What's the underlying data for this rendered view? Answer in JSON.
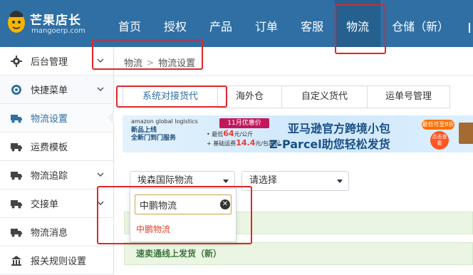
{
  "brand": {
    "name": "芒果店长",
    "url": "mangoerp.com"
  },
  "top_nav": [
    {
      "label": "首页"
    },
    {
      "label": "授权"
    },
    {
      "label": "产品"
    },
    {
      "label": "订单"
    },
    {
      "label": "客服"
    },
    {
      "label": "物流",
      "active": true
    },
    {
      "label": "仓储（新）"
    }
  ],
  "sidebar": {
    "items": [
      {
        "label": "后台管理",
        "icon": "gear-icon"
      },
      {
        "label": "快捷菜单",
        "icon": "target-icon"
      },
      {
        "label": "物流设置",
        "icon": "truck-icon"
      },
      {
        "label": "运费模板",
        "icon": "truck-icon"
      },
      {
        "label": "物流追踪",
        "icon": "truck-icon"
      },
      {
        "label": "交接单",
        "icon": "truck-icon"
      },
      {
        "label": "物流消息",
        "icon": "truck-icon"
      },
      {
        "label": "报关规则设置",
        "icon": "bank-icon"
      }
    ]
  },
  "breadcrumb": {
    "root": "物流",
    "separator": ">",
    "current": "物流设置"
  },
  "tabs": [
    {
      "label": "系统对接货代"
    },
    {
      "label": "海外仓"
    },
    {
      "label": "自定义货代"
    },
    {
      "label": "运单号管理"
    }
  ],
  "banner": {
    "brand_line": "amazon global logistics",
    "left_line1": "新品上线",
    "left_line2": "全新门到门服务",
    "sale_badge": "11月优惠价",
    "price_line1_prefix": "最低",
    "price_line1_value": "64",
    "price_line1_suffix": "元/公斤",
    "price_line2_prefix": "基础运费",
    "price_line2_value": "14.4",
    "price_line2_suffix": "元/包裹起",
    "title": "亚马逊官方跨境小包",
    "subtitle": "Z-Parcel助您轻松发货",
    "discount_tag": "最低可至8折",
    "cta": "点击查看"
  },
  "filters": {
    "forwarder_selected": "埃森国际物流",
    "choose_placeholder": "请选择"
  },
  "dropdown": {
    "search_value": "中鹏物流",
    "option": "中鹏物流"
  },
  "rows": [
    {
      "label": ""
    },
    {
      "label": "速卖通线上发货（新）"
    }
  ],
  "colors": {
    "nav_bg": "#2f6fa4",
    "annotation": "#e0262a",
    "green_row": "#eaf5e3"
  }
}
